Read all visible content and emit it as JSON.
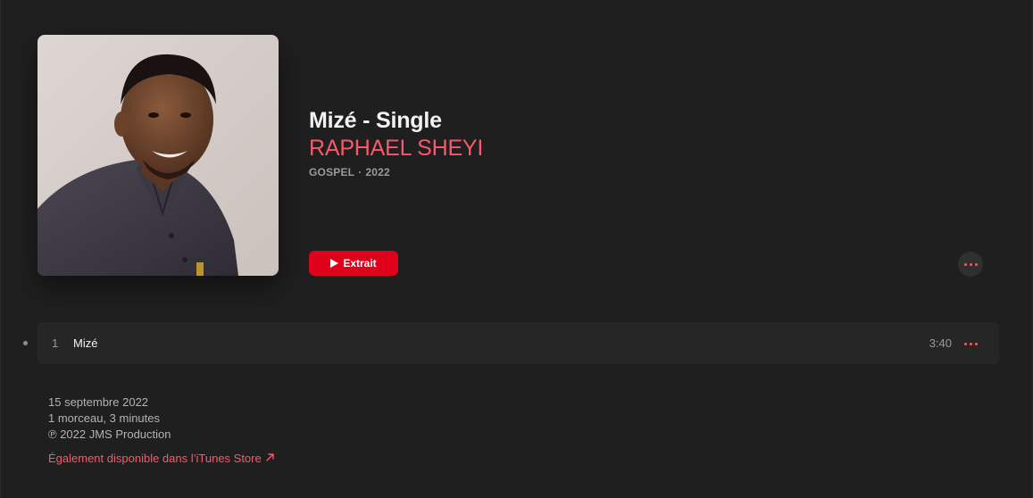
{
  "album": {
    "title": "Mizé - Single",
    "artist": "RAPHAEL SHEYI",
    "genre": "GOSPEL",
    "separator": "·",
    "year": "2022",
    "artwork_icon": "artist-portrait-artwork"
  },
  "actions": {
    "preview_label": "Extrait",
    "play_icon": "play-icon",
    "more_icon": "more-options-icon"
  },
  "tracks": [
    {
      "number": "1",
      "title": "Mizé",
      "duration": "3:40"
    }
  ],
  "footer": {
    "release_date": "15 septembre 2022",
    "summary": "1 morceau, 3 minutes",
    "copyright": "℗ 2022 JMS Production",
    "itunes_link": "Également disponible dans l’iTunes Store",
    "link_icon": "external-arrow-icon"
  },
  "colors": {
    "background": "#1f1f1f",
    "accent": "#fa586a",
    "button_red": "#e1001c",
    "row_background": "#262626",
    "secondary_text": "#9a9a9a"
  }
}
